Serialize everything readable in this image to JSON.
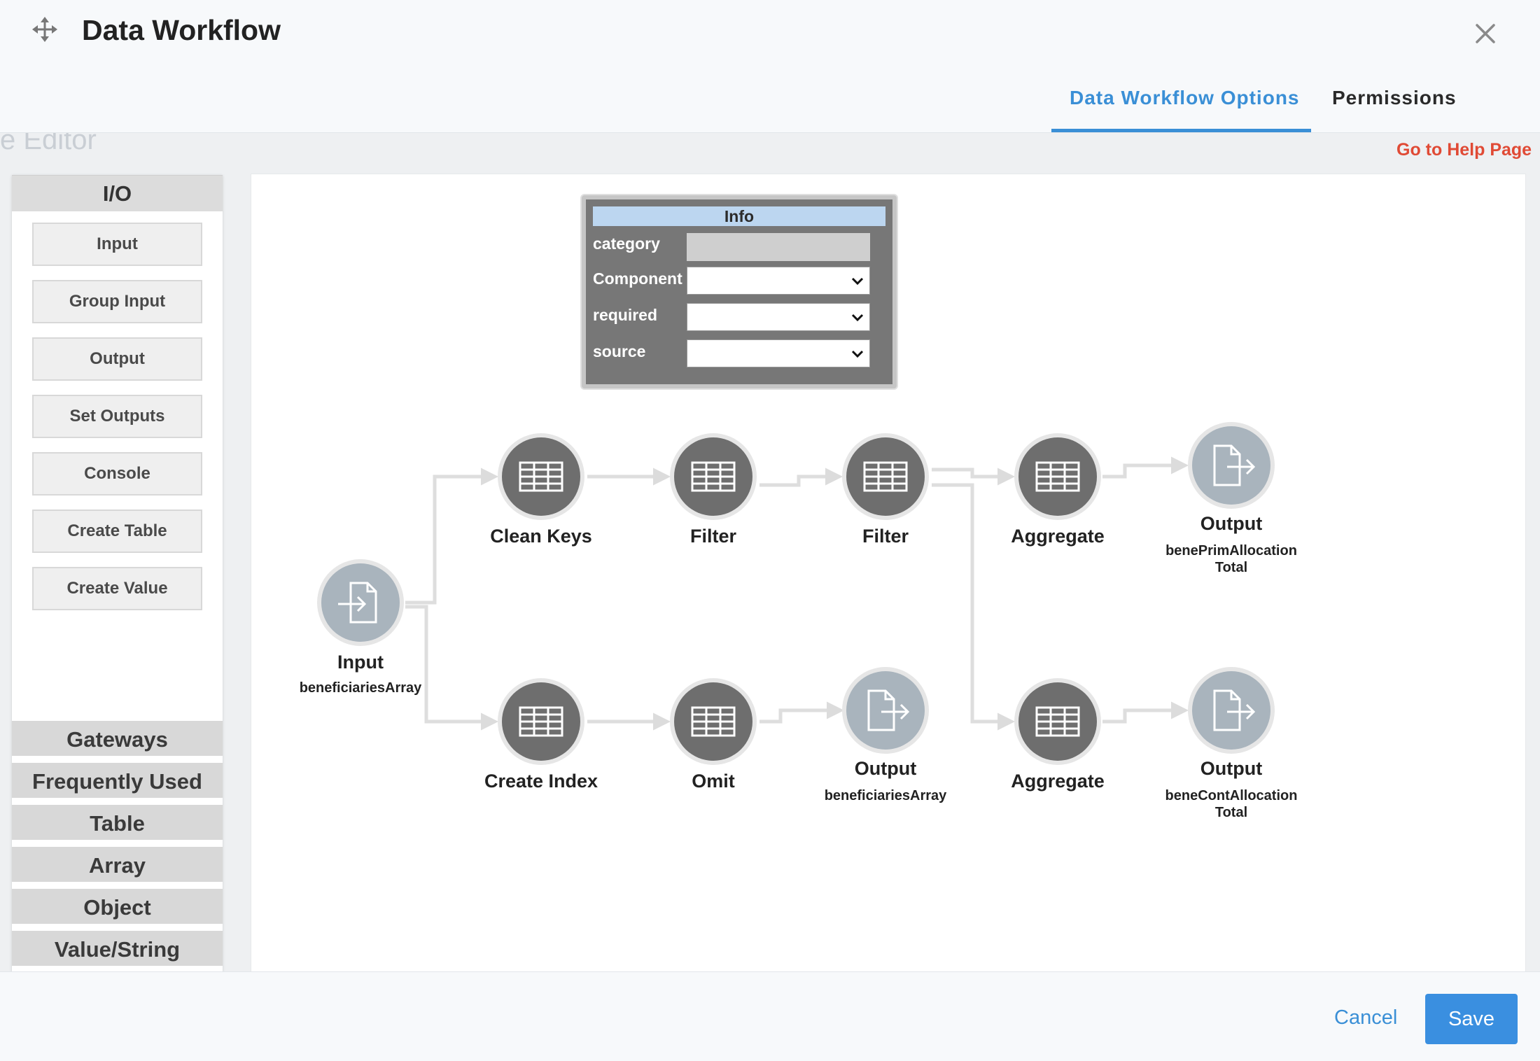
{
  "window": {
    "title": "Data Workflow",
    "close_icon": "close-icon",
    "move_icon": "move-icon"
  },
  "tabs": [
    {
      "label": "Data Workflow Options",
      "active": true
    },
    {
      "label": "Permissions",
      "active": false
    }
  ],
  "help_link": "Go to Help Page",
  "palette": {
    "header": "I/O",
    "items": [
      "Input",
      "Group Input",
      "Output",
      "Set Outputs",
      "Console",
      "Create Table",
      "Create Value"
    ],
    "categories": [
      "Gateways",
      "Frequently Used",
      "Table",
      "Array",
      "Object",
      "Value/String"
    ]
  },
  "info_panel": {
    "title": "Info",
    "rows": [
      {
        "label": "category",
        "value": "",
        "type": "text"
      },
      {
        "label": "Component",
        "value": "",
        "type": "select"
      },
      {
        "label": "required",
        "value": "",
        "type": "select"
      },
      {
        "label": "source",
        "value": "",
        "type": "select"
      }
    ]
  },
  "nodes": [
    {
      "id": "input",
      "label": "Input",
      "sub": "beneficiariesArray",
      "kind": "io-in"
    },
    {
      "id": "clean-keys",
      "label": "Clean Keys",
      "sub": "",
      "kind": "table"
    },
    {
      "id": "filter-1",
      "label": "Filter",
      "sub": "",
      "kind": "table"
    },
    {
      "id": "filter-2",
      "label": "Filter",
      "sub": "",
      "kind": "table"
    },
    {
      "id": "aggregate-1",
      "label": "Aggregate",
      "sub": "",
      "kind": "table"
    },
    {
      "id": "output-1",
      "label": "Output",
      "sub": "benePrimAllocationTotal",
      "kind": "io-out"
    },
    {
      "id": "create-index",
      "label": "Create Index",
      "sub": "",
      "kind": "table"
    },
    {
      "id": "omit",
      "label": "Omit",
      "sub": "",
      "kind": "table"
    },
    {
      "id": "output-2",
      "label": "Output",
      "sub": "beneficiariesArray",
      "kind": "io-out"
    },
    {
      "id": "aggregate-2",
      "label": "Aggregate",
      "sub": "",
      "kind": "table"
    },
    {
      "id": "output-3",
      "label": "Output",
      "sub": "beneContAllocationTotal",
      "kind": "io-out"
    }
  ],
  "colors": {
    "accent": "#3a8fd6",
    "help": "#e04a35",
    "table_node": "#6e6e6e",
    "io_node": "#a9b4bd"
  },
  "footer": {
    "cancel_label": "Cancel",
    "save_label": "Save"
  }
}
